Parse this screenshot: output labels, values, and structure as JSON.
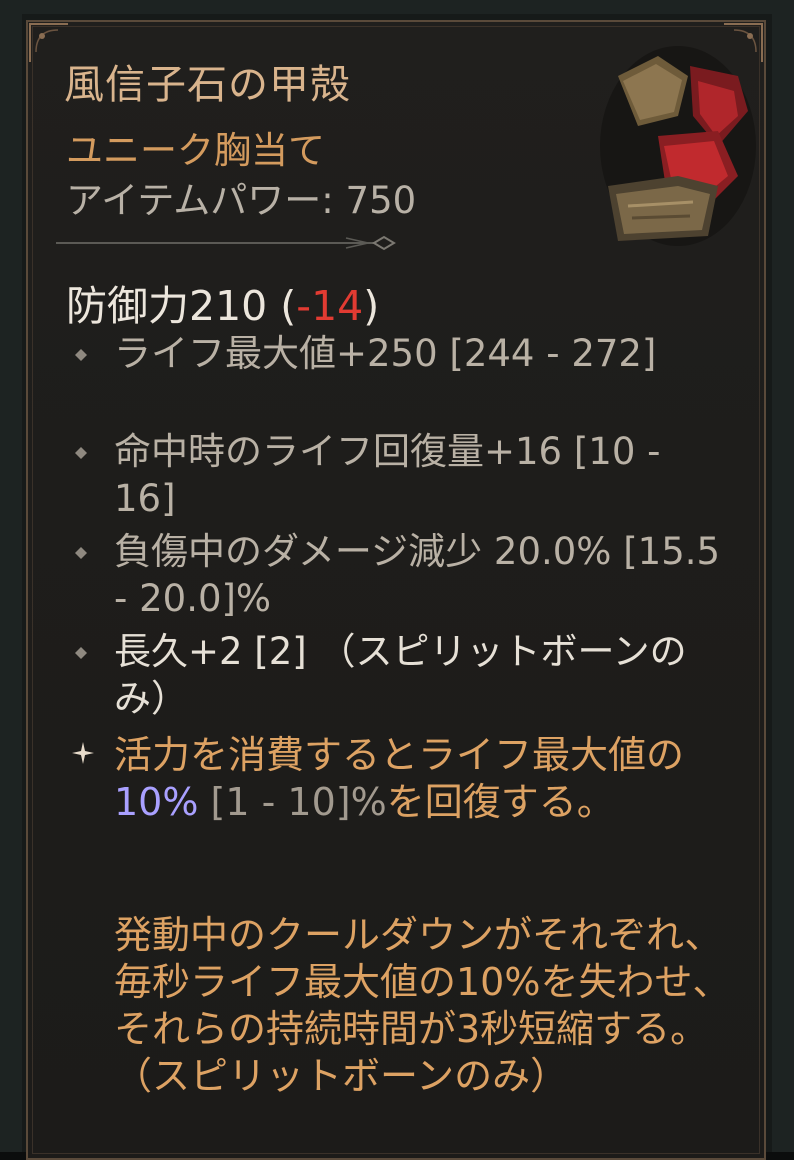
{
  "tooltip": {
    "item_name": "風信子石の甲殻",
    "item_type": "ユニーク胸当て",
    "item_power_label": "アイテムパワー: 750",
    "defense_label": "防御力210",
    "defense_open": " (",
    "defense_diff": "-14",
    "defense_close": ")",
    "affixes": [
      "ライフ最大値+250 [244 - 272]",
      "命中時のライフ回復量+16 [10 - 16]",
      "負傷中のダメージ減少 20.0% [15.5 - 20.0]%",
      "長久+2 [2] （スピリットボーンのみ）"
    ],
    "unique_power": {
      "prefix": "活力を消費するとライフ最大値の",
      "value": "10%",
      "range": " [1 - 10]%",
      "suffix": "を回復する。"
    },
    "flavor_text": "発動中のクールダウンがそれぞれ、毎秒ライフ最大値の10%を失わせ、それらの持続時間が3秒短縮する。 （スピリットボーンのみ）"
  },
  "colors": {
    "name": "#d9b48d",
    "unique_orange": "#dda263",
    "negative": "#e23b32",
    "highlight_value": "#a9a0ff"
  }
}
